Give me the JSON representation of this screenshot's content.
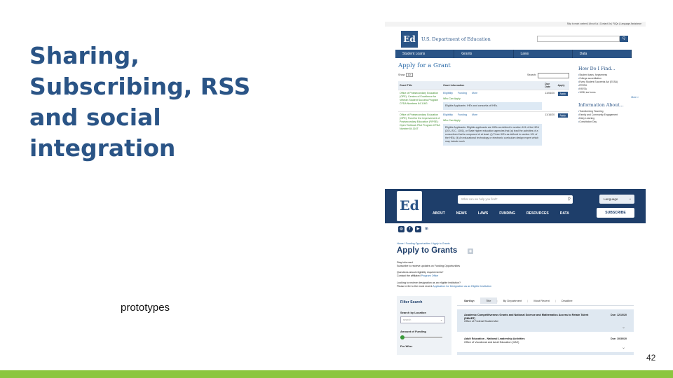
{
  "slide": {
    "title": "Sharing, Subscribing, RSS and social integration",
    "caption": "prototypes",
    "slide_number": "42",
    "accent_color": "#2a5486",
    "bar_color": "#8cc63f"
  },
  "old_site": {
    "utility_links": "Skip to main content | About Us | Contact Us | FAQs | Language Assistance",
    "logo_text": "Ed",
    "agency_name": "U.S. Department of Education",
    "search_button": "Q",
    "nav": [
      "Student Loans",
      "Grants",
      "Laws",
      "Data"
    ],
    "page_title": "Apply for a Grant",
    "show_label": "Show",
    "show_value": "10",
    "search_label": "Search:",
    "table": {
      "headers": [
        "Grant Title",
        "Grant Information",
        "Due Date",
        "Apply"
      ],
      "rows": [
        {
          "title": "Office of Postsecondary Education (OPE): Centers of Excellence for Veteran Student Success Program CFDA Numbers 84.116G",
          "eligibility": "Eligibility",
          "funding": "Funding",
          "more": "More",
          "who": "Who Can Apply",
          "applicants": "Eligible Applicants: IHEs and consortia of IHEs.",
          "due": "11/04/20",
          "apply": "Apply"
        },
        {
          "title": "Office of Postsecondary Education (OPE): Fund for the Improvement of Postsecondary Education (FIPSE): Open Textbook Pilot Program CFDA Number 84.116T",
          "eligibility": "Eligibility",
          "funding": "Funding",
          "more": "More",
          "who": "Who Can Apply",
          "applicants": "Eligible Applicants: Eligible applicants are IHEs as defined in section 101 of the HEA (20 U.S.C. 1001), or State higher education agencies that (a) lead the activities of a consortium that is composed of at least: (i) Three IHEs as defined in section 101 of the HEA; (ii) An educational technology or electronic curriculum design expert which may include such",
          "due": "11/16/20",
          "apply": "Apply"
        }
      ]
    },
    "how_do_i": {
      "title": "How Do I Find...",
      "items": [
        "Student loans, forgiveness",
        "College accreditation",
        "Every Student Succeeds Act (ESSA)",
        "FERPA",
        "FAFSA",
        "1098, tax forms"
      ],
      "more": "More >"
    },
    "info_about": {
      "title": "Information About...",
      "items": [
        "Transforming Teaching",
        "Family and Community Engagement",
        "Early Learning",
        "Constitution Day"
      ]
    }
  },
  "new_site": {
    "logo_text": "Ed",
    "search_placeholder": "What can we help you find?",
    "language_label": "Language",
    "nav": [
      "ABOUT",
      "NEWS",
      "LAWS",
      "FUNDING",
      "RESOURCES",
      "DATA"
    ],
    "subscribe_label": "SUBSCRIBE",
    "social": [
      "instagram-icon",
      "facebook-icon",
      "youtube-icon",
      "linkedin-icon"
    ],
    "breadcrumb": "Home  /  Funding Opportunities  /  Apply to Grants",
    "page_title": "Apply to Grants",
    "stay_informed": "Stay informed",
    "subscribe_text": "Subscribe to recieve updates on Funding Opportunities",
    "questions": "Questions about eligibility requirements?",
    "contact_prefix": "Contact the affiliated ",
    "contact_link": "Program Office",
    "looking": "Looking to recieve designation as an eligible institution?",
    "refer_prefix": "Please refer to the most recent ",
    "refer_link": "Application for Designation as an Eligible Institution",
    "filter": {
      "title": "Filter Search",
      "location_label": "Search by Location",
      "location_placeholder": "search",
      "funding_label": "Amount of Funding",
      "for_who_label": "For Who:"
    },
    "sort": {
      "label": "Sort by:",
      "options": [
        "Title",
        "By Department",
        "Most Recent",
        "Deadline"
      ]
    },
    "results": [
      {
        "title": "Academic Competitiveness Grants and National Science and Mathematics Access to Retain Talent (SMART)",
        "office": "Office of Federal Student Aid",
        "due": "Due: 12/10/20"
      },
      {
        "title": "Adult Education - National Leadership Activities",
        "office": "Office of Vocational and Adult Education (VAE)",
        "due": "Due: 10/30/20"
      }
    ]
  }
}
